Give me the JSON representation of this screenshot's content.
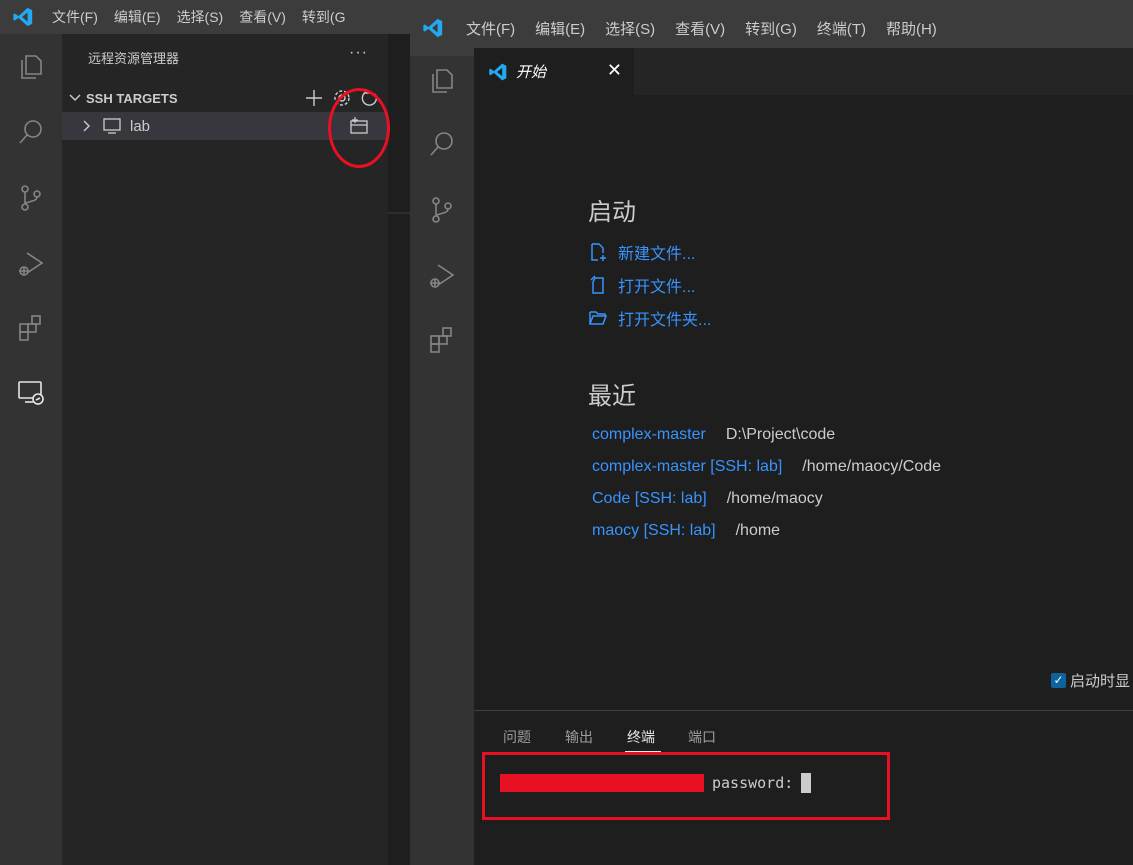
{
  "back_window": {
    "menu": [
      "文件(F)",
      "编辑(E)",
      "选择(S)",
      "查看(V)",
      "转到(G"
    ],
    "sidebar": {
      "title": "远程资源管理器",
      "more": "···",
      "section": "SSH TARGETS",
      "item": "lab"
    }
  },
  "front_window": {
    "menu": [
      "文件(F)",
      "编辑(E)",
      "选择(S)",
      "查看(V)",
      "转到(G)",
      "终端(T)",
      "帮助(H)"
    ],
    "tab": {
      "label": "开始",
      "close": "✕"
    },
    "welcome": {
      "start_heading": "启动",
      "start_links": [
        "新建文件...",
        "打开文件...",
        "打开文件夹..."
      ],
      "recent_heading": "最近",
      "recent": [
        {
          "name": "complex-master",
          "path": "D:\\Project\\code"
        },
        {
          "name": "complex-master [SSH: lab]",
          "path": "/home/maocy/Code"
        },
        {
          "name": "Code [SSH: lab]",
          "path": "/home/maocy"
        },
        {
          "name": "maocy [SSH: lab]",
          "path": "/home"
        }
      ],
      "startup_checkbox": "启动时显"
    },
    "panel": {
      "tabs": [
        "问题",
        "输出",
        "终端",
        "端口"
      ],
      "active_tab": "终端",
      "terminal_prompt": "password:"
    }
  },
  "colors": {
    "accent_link": "#3794ff",
    "annotation_red": "#e81123",
    "vscode_blue": "#23a9f2"
  }
}
